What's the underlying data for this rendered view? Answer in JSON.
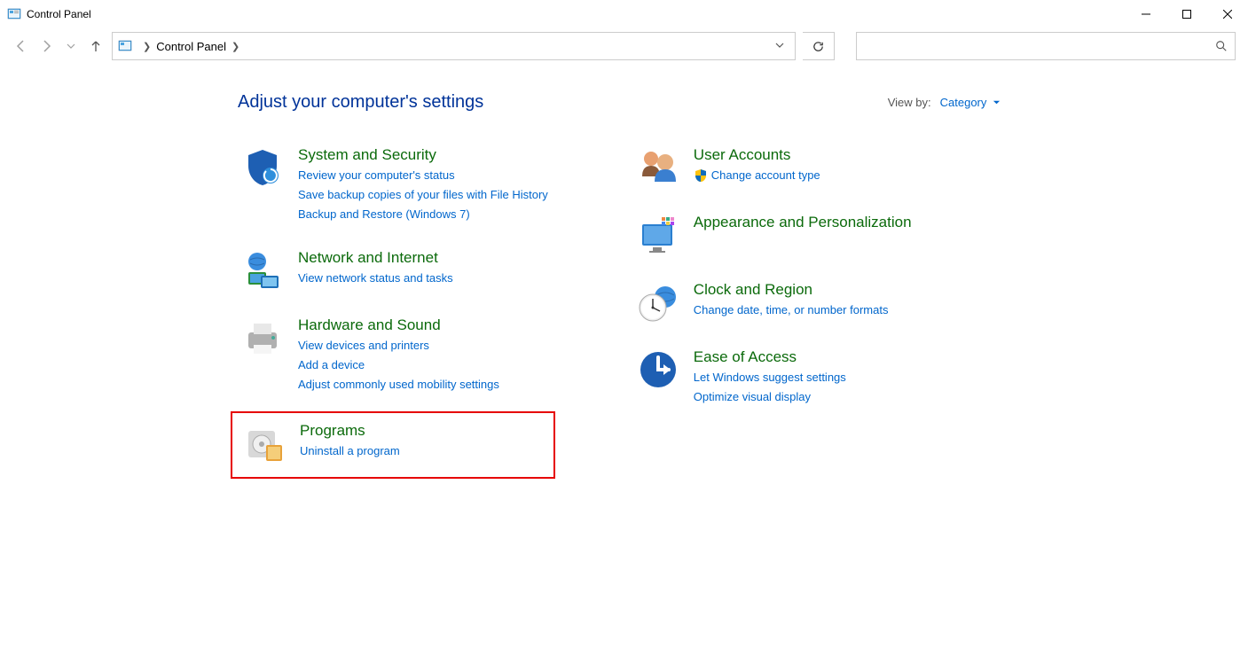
{
  "window": {
    "title": "Control Panel"
  },
  "breadcrumb": {
    "current": "Control Panel"
  },
  "header": {
    "heading": "Adjust your computer's settings",
    "viewby_label": "View by:",
    "viewby_value": "Category"
  },
  "categories": {
    "left": [
      {
        "title": "System and Security",
        "links": [
          "Review your computer's status",
          "Save backup copies of your files with File History",
          "Backup and Restore (Windows 7)"
        ]
      },
      {
        "title": "Network and Internet",
        "links": [
          "View network status and tasks"
        ]
      },
      {
        "title": "Hardware and Sound",
        "links": [
          "View devices and printers",
          "Add a device",
          "Adjust commonly used mobility settings"
        ]
      },
      {
        "title": "Programs",
        "links": [
          "Uninstall a program"
        ]
      }
    ],
    "right": [
      {
        "title": "User Accounts",
        "links": [
          "Change account type"
        ],
        "shield": true
      },
      {
        "title": "Appearance and Personalization",
        "links": []
      },
      {
        "title": "Clock and Region",
        "links": [
          "Change date, time, or number formats"
        ]
      },
      {
        "title": "Ease of Access",
        "links": [
          "Let Windows suggest settings",
          "Optimize visual display"
        ]
      }
    ]
  }
}
